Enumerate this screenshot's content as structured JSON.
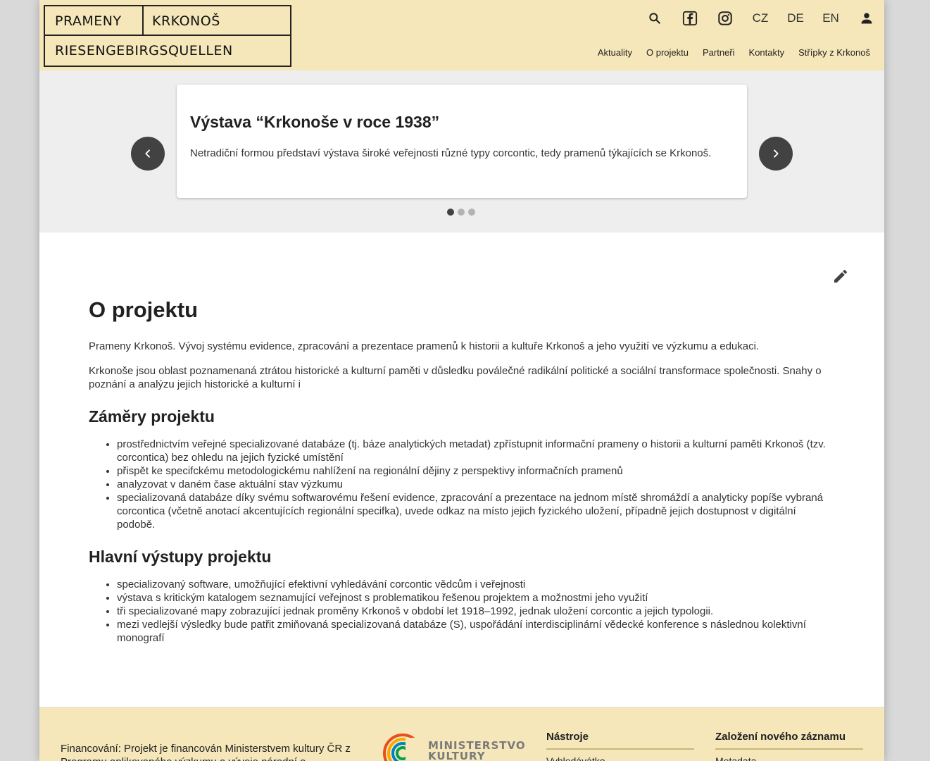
{
  "header": {
    "logo": {
      "line1_left": "PRAMENY",
      "line1_right": "KRKONOŠ",
      "line2": "RIESENGEBIRGSQUELLEN"
    },
    "languages": [
      "CZ",
      "DE",
      "EN"
    ],
    "icons": [
      "search-icon",
      "facebook-icon",
      "instagram-icon",
      "user-icon"
    ],
    "nav": [
      "Aktuality",
      "O projektu",
      "Partneři",
      "Kontakty",
      "Střípky z Krkonoš"
    ]
  },
  "carousel": {
    "title": "Výstava “Krkonoše v roce 1938”",
    "text": "Netradiční formou představí výstava široké veřejnosti různé typy corcontic, tedy pramenů týkajících se Krkonoš.",
    "slide_count": 3,
    "active_slide": 1
  },
  "content": {
    "title": "O projektu",
    "p1": "Prameny Krkonoš. Vývoj systému evidence, zpracování a prezentace pramenů k historii a kultuře Krkonoš a jeho využití ve výzkumu a edukaci.",
    "p2": "Krkonoše jsou oblast poznamenaná ztrátou historické a kulturní paměti v důsledku poválečné radikální politické a sociální transformace společnosti. Snahy o poznání a analýzu jejich historické a kulturní i",
    "section1": {
      "heading": "Záměry projektu",
      "items": [
        "prostřednictvím veřejné specializované databáze (tj. báze analytických metadat) zpřístupnit informační prameny o historii a kulturní paměti Krkonoš (tzv. corcontica) bez ohledu na jejich fyzické umístění",
        "přispět ke specifckému metodologickému nahlížení na regionální dějiny z perspektivy informačních pramenů",
        "analyzovat v daném čase aktuální stav výzkumu",
        "specializovaná databáze díky svému softwarovému řešení evidence, zpracování a prezentace na jednom místě shromáždí a analyticky popíše vybraná corcontica (včetně anotací akcentujících regionální specifka), uvede odkaz na místo jejich fyzického uložení, případně jejich dostupnost v digitální podobě."
      ]
    },
    "section2": {
      "heading": "Hlavní výstupy projektu",
      "items": [
        "specializovaný software, umožňující efektivní vyhledávání corcontic vědcům i veřejnosti",
        "výstava s kritickým katalogem seznamující veřejnost s problematikou řešenou projektem a možnostmi jeho využití",
        "tři specializované mapy zobrazující jednak proměny Krkonoš v období let 1918–1992, jednak uložení corcontic a jejich typologii.",
        "mezi vedlejší výsledky bude patřit zmiňovaná specializovaná databáze (S), uspořádání interdisciplinární vědecké konference s následnou kolektivní monografí"
      ]
    }
  },
  "footer": {
    "financing": "Financování: Projekt je financován Ministerstvem kultury ČR z Programu aplikovaného výzkumu a vývoje národní a",
    "ministry_logo_line1": "MINISTERSTVO",
    "ministry_logo_line2": "KULTURY",
    "col1": {
      "heading": "Nástroje",
      "link": "Vyhledávátko"
    },
    "col2": {
      "heading": "Založení nového záznamu",
      "link": "Metadata"
    }
  },
  "colors": {
    "header_bg": "#f5e7b9",
    "carousel_bg": "#eeeeee",
    "arrow_bg": "#424242",
    "footer_rule": "#c8b77a"
  }
}
